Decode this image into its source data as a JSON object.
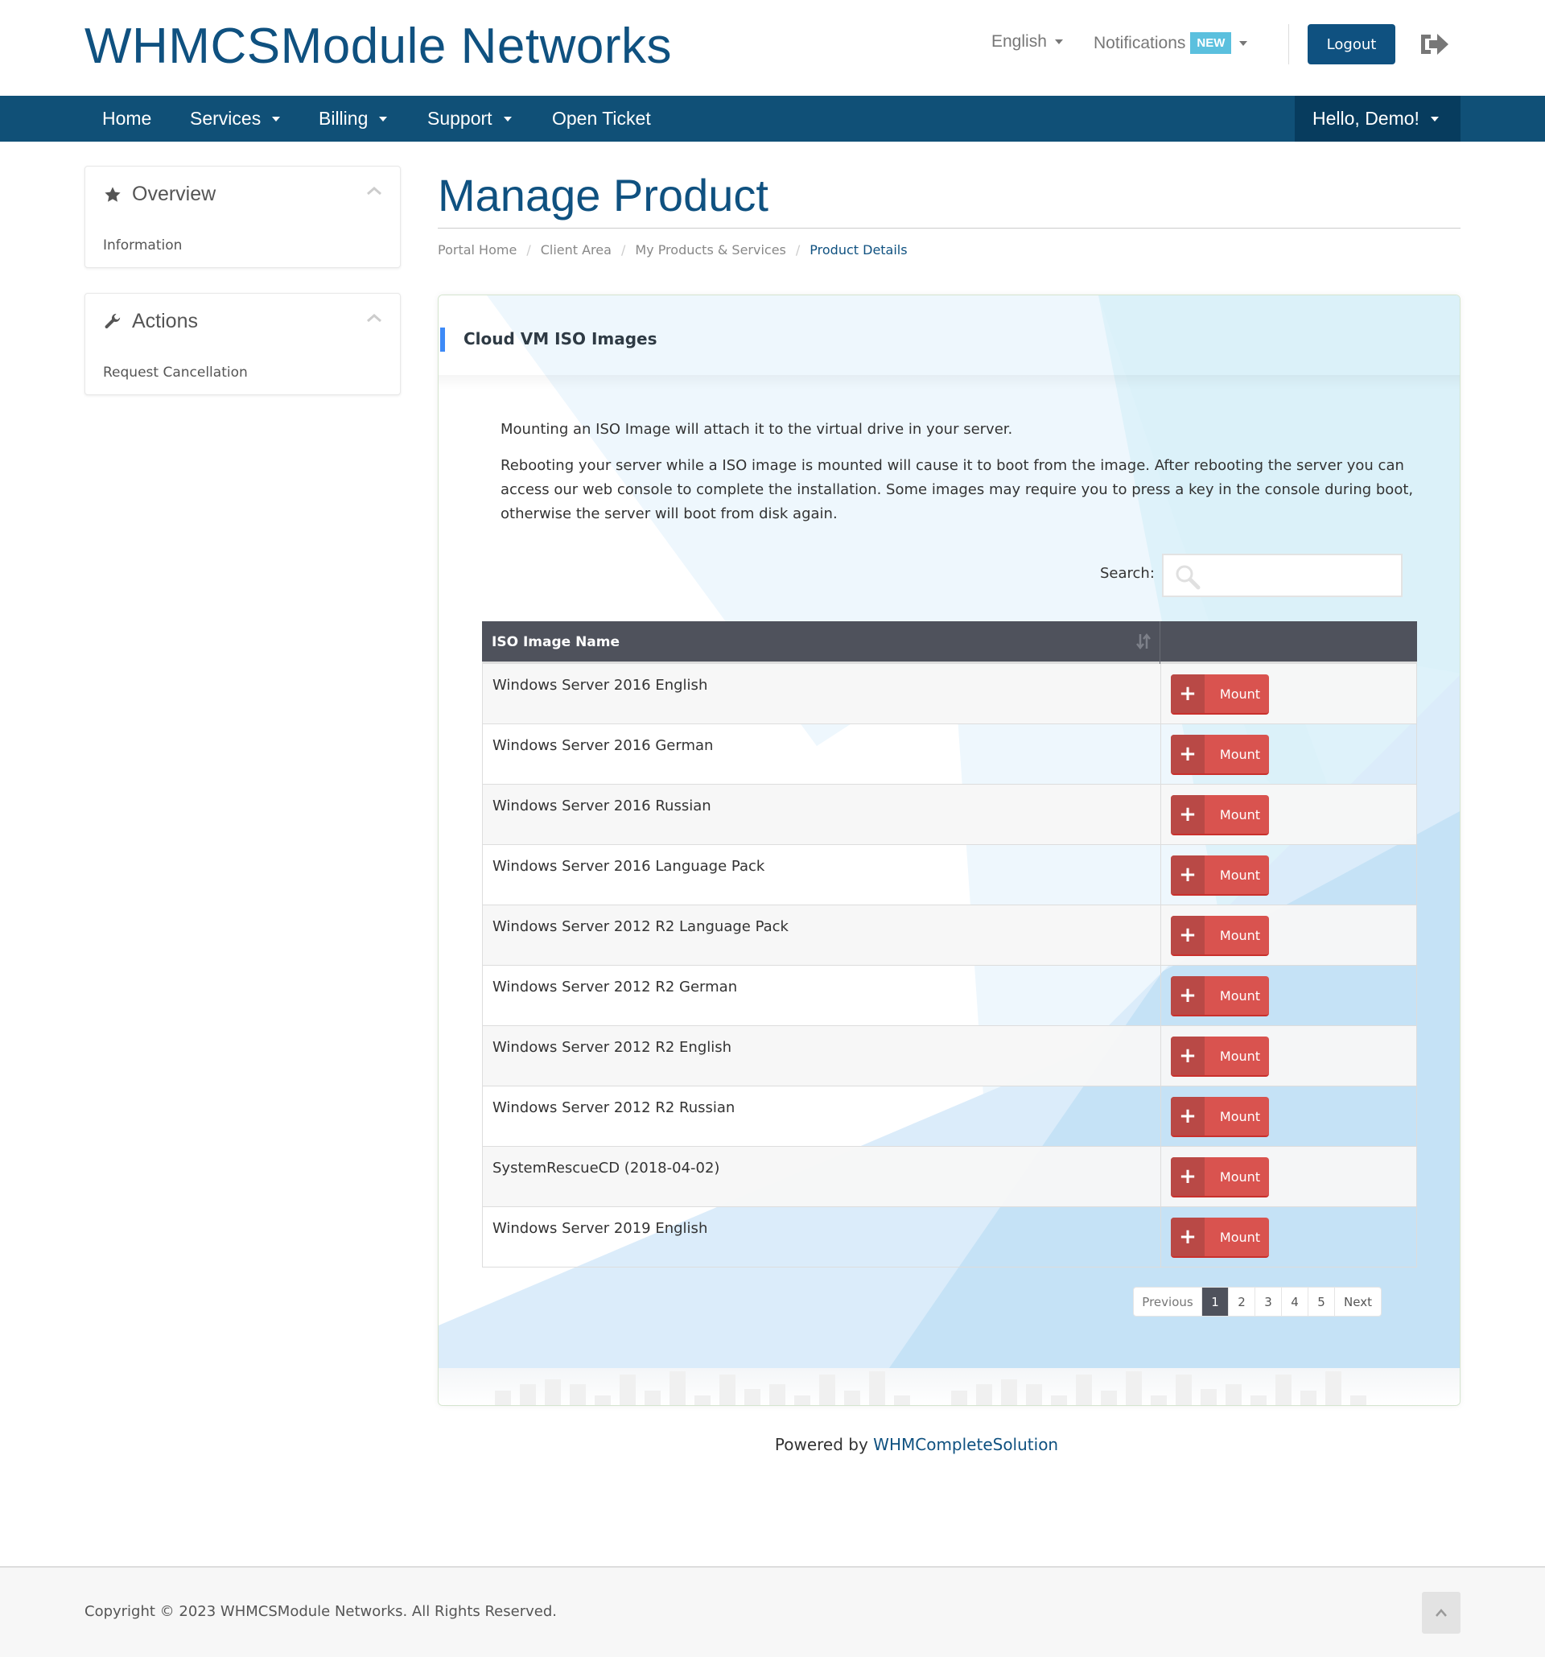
{
  "header": {
    "logo": "WHMCSModule Networks",
    "language": "English",
    "notifications_label": "Notifications",
    "notifications_badge": "NEW",
    "logout_label": "Logout"
  },
  "nav": {
    "items": [
      {
        "label": "Home",
        "dropdown": false
      },
      {
        "label": "Services",
        "dropdown": true
      },
      {
        "label": "Billing",
        "dropdown": true
      },
      {
        "label": "Support",
        "dropdown": true
      },
      {
        "label": "Open Ticket",
        "dropdown": false
      }
    ],
    "user_greeting": "Hello, Demo!"
  },
  "sidebar": {
    "panels": [
      {
        "title": "Overview",
        "icon": "star-icon",
        "links": [
          "Information"
        ]
      },
      {
        "title": "Actions",
        "icon": "wrench-icon",
        "links": [
          "Request Cancellation"
        ]
      }
    ]
  },
  "main": {
    "page_title": "Manage Product",
    "breadcrumb": [
      "Portal Home",
      "Client Area",
      "My Products & Services",
      "Product Details"
    ],
    "panel": {
      "title": "Cloud VM ISO Images",
      "description_1": "Mounting an ISO Image will attach it to the virtual drive in your server.",
      "description_2": "Rebooting your server while a ISO image is mounted will cause it to boot from the image. After rebooting the server you can access our web console to complete the installation. Some images may require you to press a key in the console during boot, otherwise the server will boot from disk again.",
      "search_label": "Search:",
      "search_value": "",
      "table": {
        "column_header": "ISO Image Name",
        "action_label": "Mount",
        "rows": [
          "Windows Server 2016 English",
          "Windows Server 2016 German",
          "Windows Server 2016 Russian",
          "Windows Server 2016 Language Pack",
          "Windows Server 2012 R2 Language Pack",
          "Windows Server 2012 R2 German",
          "Windows Server 2012 R2 English",
          "Windows Server 2012 R2 Russian",
          "SystemRescueCD (2018-04-02)",
          "Windows Server 2019 English"
        ]
      },
      "pagination": {
        "previous": "Previous",
        "pages": [
          "1",
          "2",
          "3",
          "4",
          "5"
        ],
        "current": "1",
        "next": "Next"
      }
    }
  },
  "powered_by": {
    "prefix": "Powered by",
    "link": "WHMCompleteSolution"
  },
  "footer": {
    "copyright": "Copyright © 2023 WHMCSModule Networks. All Rights Reserved."
  },
  "colors": {
    "brand": "#0f5180",
    "nav_bg": "#105077",
    "mount": "#d9534f",
    "badge": "#5bc0de",
    "table_header": "#4f525c"
  }
}
